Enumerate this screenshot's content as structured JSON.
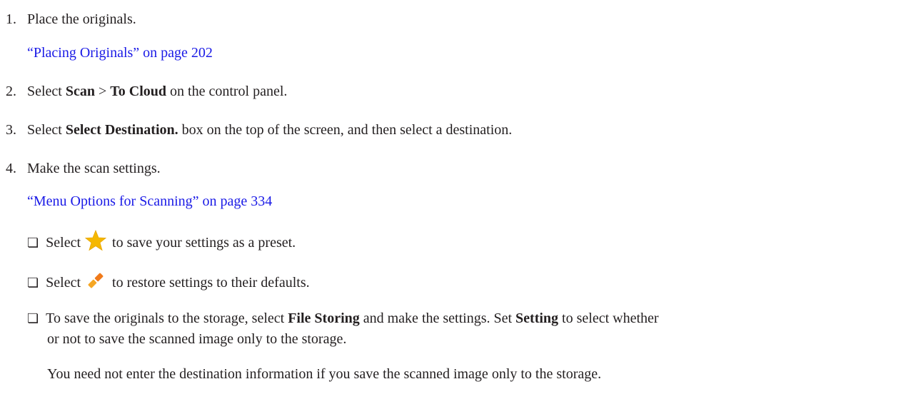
{
  "steps": [
    {
      "number": "1.",
      "text": "Place the originals."
    },
    {
      "number": "2.",
      "pre": "Select ",
      "bold1": "Scan",
      "mid": " > ",
      "bold2": "To Cloud",
      "post": " on the control panel."
    },
    {
      "number": "3.",
      "pre": "Select ",
      "bold1": "Select Destination.",
      "post": " box on the top of the screen, and then select a destination."
    },
    {
      "number": "4.",
      "text": "Make the scan settings."
    }
  ],
  "links": {
    "placing": "“Placing Originals” on page 202",
    "menu_options": "“Menu Options for Scanning” on page 334"
  },
  "bullets": {
    "box_glyph": "❏",
    "preset": {
      "pre": "Select",
      "post": "to save your settings as a preset."
    },
    "restore": {
      "pre": "Select",
      "post": "to restore settings to their defaults."
    },
    "storage": {
      "pre": "To save the originals to the storage, select ",
      "bold1": "File Storing",
      "mid": " and make the settings. Set ",
      "bold2": "Setting",
      "post": " to select whether",
      "line2": "or not to save the scanned image only to the storage."
    }
  },
  "note": "You need not enter the destination information if you save the scanned image only to the storage.",
  "icons": {
    "star": {
      "name": "star-icon",
      "color": "#f5b800"
    },
    "reset": {
      "name": "reset-icon",
      "color": "#f0a020"
    }
  }
}
